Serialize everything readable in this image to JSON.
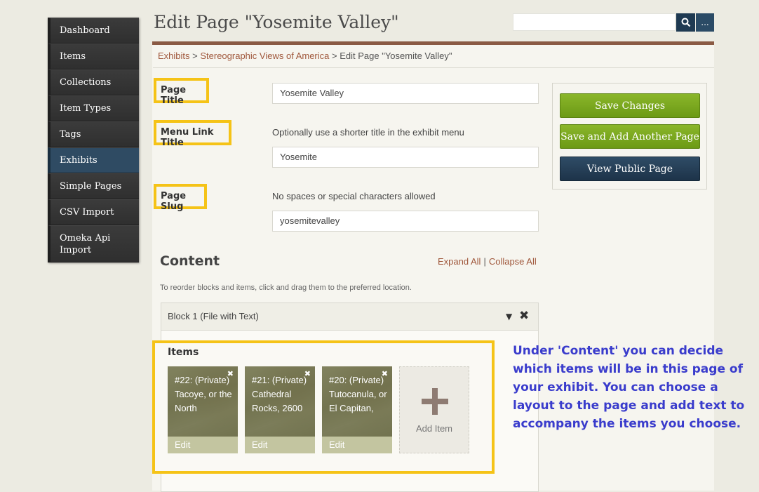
{
  "nav": {
    "items": [
      {
        "label": "Dashboard"
      },
      {
        "label": "Items"
      },
      {
        "label": "Collections"
      },
      {
        "label": "Item Types"
      },
      {
        "label": "Tags"
      },
      {
        "label": "Exhibits"
      },
      {
        "label": "Simple Pages"
      },
      {
        "label": "CSV Import"
      },
      {
        "label": "Omeka Api Import"
      }
    ],
    "active": "Exhibits"
  },
  "header": {
    "title": "Edit Page \"Yosemite Valley\"",
    "search_value": "",
    "advanced_label": "..."
  },
  "breadcrumb": {
    "exhibits": "Exhibits",
    "sep1": " > ",
    "exhibit": "Stereographic Views of America",
    "sep2": " > ",
    "current": "Edit Page \"Yosemite Valley\""
  },
  "form": {
    "page_title_label": "Page Title",
    "page_title_value": "Yosemite Valley",
    "menu_link_label": "Menu Link Title",
    "menu_link_hint": "Optionally use a shorter title in the exhibit menu",
    "menu_link_value": "Yosemite",
    "slug_label": "Page Slug",
    "slug_hint": "No spaces or special characters allowed",
    "slug_value": "yosemitevalley"
  },
  "actions": {
    "save": "Save Changes",
    "save_add": "Save and Add Another Page",
    "view": "View Public Page"
  },
  "content": {
    "heading": "Content",
    "expand_all": "Expand All",
    "separator": "|",
    "collapse_all": "Collapse All",
    "reorder_hint": "To reorder blocks and items, click and drag them to the preferred location.",
    "block_title": "Block 1 (File with Text)",
    "items_heading": "Items",
    "items": [
      {
        "caption": "#22: (Private) Tacoye, or the North",
        "edit": "Edit"
      },
      {
        "caption": "#21: (Private) Cathedral Rocks, 2600",
        "edit": "Edit"
      },
      {
        "caption": "#20: (Private) Tutocanula, or El Capitan,",
        "edit": "Edit"
      }
    ],
    "add_item": "Add Item"
  },
  "annotation": "Under 'Content' you can decide which items will be in this page of your exhibit. You can choose a layout to the page and add text to accompany the items you choose.",
  "colors": {
    "accent_yellow": "#f5c317",
    "link": "#a0583c",
    "green_button": "#7aa81f",
    "navy_button": "#24405a",
    "annotation_text": "#3a3ccc"
  }
}
